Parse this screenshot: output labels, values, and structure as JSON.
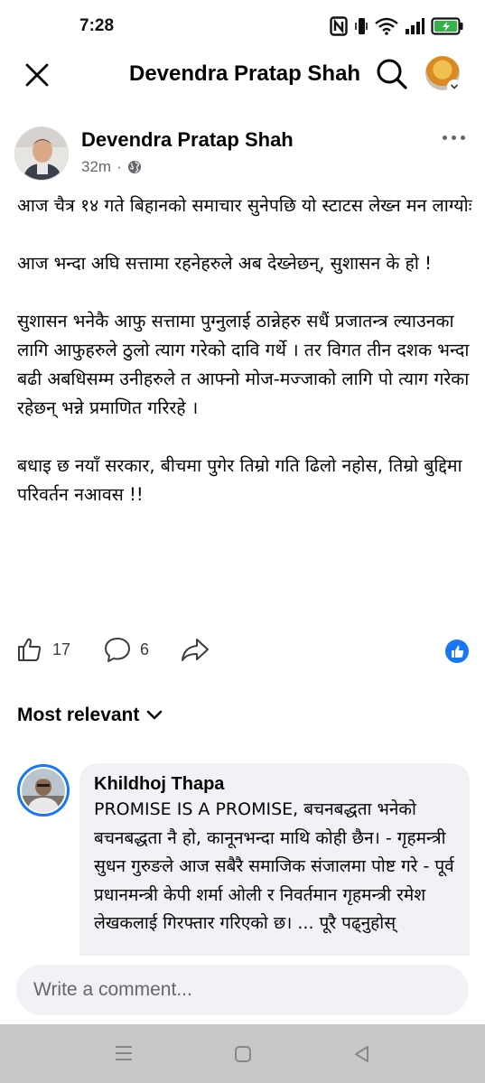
{
  "status_bar": {
    "time": "7:28",
    "icons": [
      "nfc-icon",
      "vibrate-icon",
      "wifi-icon",
      "signal-icon",
      "battery-charging-icon"
    ],
    "battery_color": "#36b24a"
  },
  "top_bar": {
    "title": "Devendra Pratap Shah"
  },
  "post": {
    "author": "Devendra Pratap Shah",
    "time": "32m",
    "separator": "·",
    "audience_icon": "globe-icon",
    "paragraphs": [
      "आज चैत्र १४ गते बिहानको समाचार सुनेपछि यो स्टाटस लेख्न मन लाग्योः",
      "आज भन्दा अघि सत्तामा रहनेहरुले अब देख्नेछन्, सुशासन के हो !",
      "सुशासन भनेकै आफु सत्तामा पुग्नुलाई ठान्नेहरु सधैं प्रजातन्त्र ल्याउनका लागि आफुहरुले ठुलो त्याग गरेको दावि गर्थे । तर विगत तीन दशक भन्दा बढी अबधिसम्म उनीहरुले त आफ्नो मोज-मज्जाको लागि पो त्याग गरेका रहेछन् भन्ने प्रमाणित गरिरहे ।",
      "बधाइ छ नयाँ सरकार, बीचमा पुगेर तिम्रो गति ढिलो नहोस, तिम्रो बुद्दिमा परिवर्तन नआवस !!"
    ],
    "likes": "17",
    "comments": "6"
  },
  "colors": {
    "accent": "#1877f2",
    "muted": "#65676b",
    "bubble": "#f0f2f5",
    "nav_bar": "#c8c8c8"
  },
  "comments_section": {
    "sort_label": "Most relevant",
    "comment": {
      "author": "Khildhoj Thapa",
      "text": "PROMISE IS A PROMISE, बचनबद्धता भनेको बचनबद्धता नै हो, कानूनभन्दा माथि कोही छैन। - गृहमन्त्री सुधन गुरुङले आज सबैरै समाजिक संजालमा पोष्ट गरे - पूर्व प्रधानमन्त्री केपी शर्मा ओली र निवर्तमान गृहमन्त्री रमेश लेखकलाई गिरफ्तार गरिएको छ। ... पूरै पढ्नुहोस्"
    }
  },
  "composer": {
    "placeholder": "Write a comment..."
  }
}
